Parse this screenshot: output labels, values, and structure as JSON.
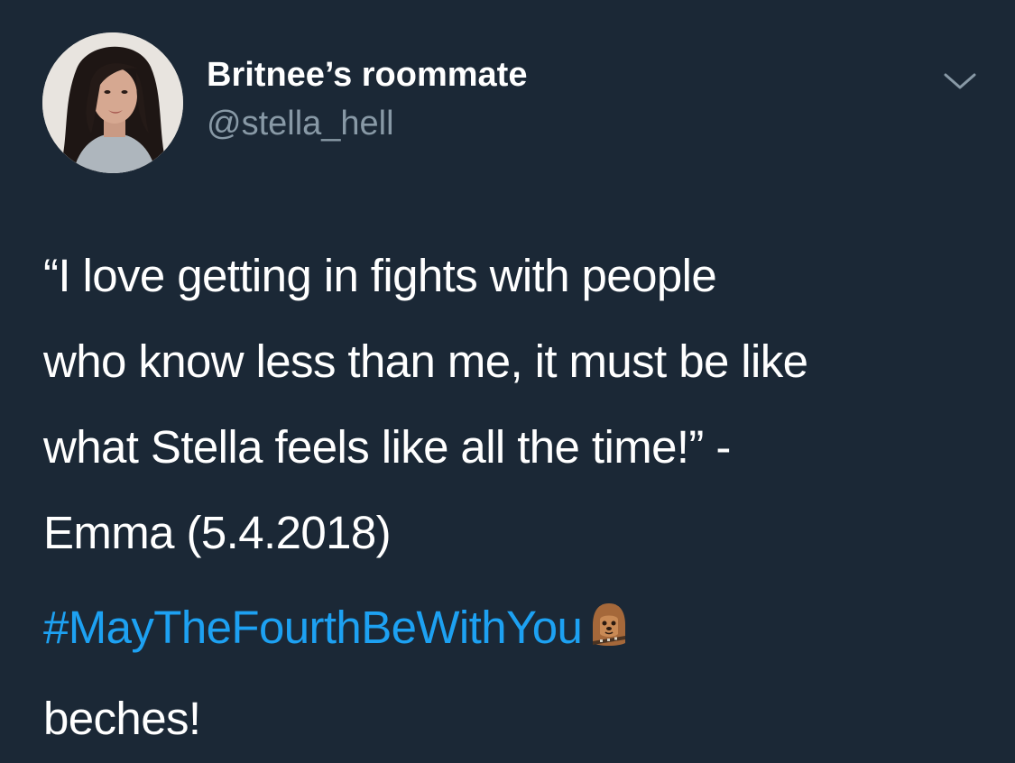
{
  "tweet": {
    "display_name": "Britnee’s roommate",
    "handle": "@stella_hell",
    "avatar_alt": "profile photo",
    "text_lines": [
      "“I love getting in fights with people",
      "who know less than me, it must be like",
      "what Stella feels like all the time!” -",
      "Emma (5.4.2018)"
    ],
    "hashtag": "#MayTheFourthBeWithYou",
    "emoji": "chewbacca-emoji",
    "closing": "beches!"
  },
  "colors": {
    "background": "#1b2836",
    "text": "#ffffff",
    "secondary": "#8899a6",
    "link": "#1da1f2"
  },
  "icons": {
    "menu": "chevron-down-icon"
  }
}
